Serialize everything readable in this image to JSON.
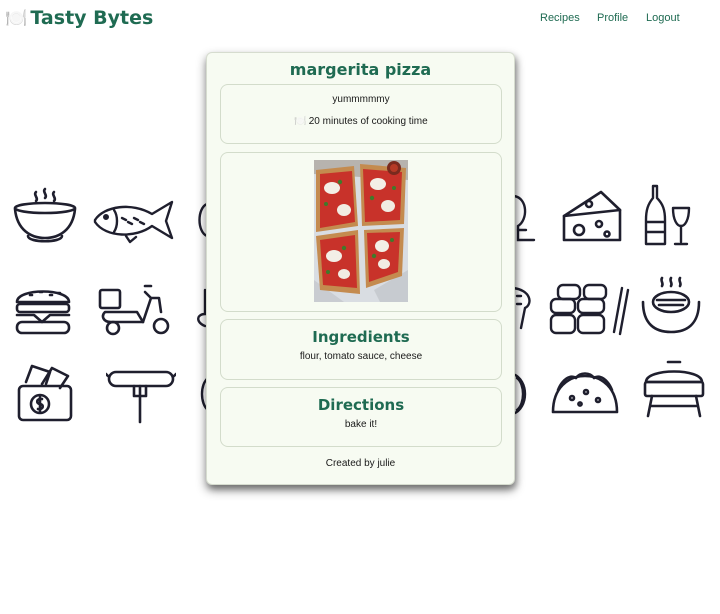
{
  "header": {
    "brand_icon": "🍽️",
    "brand_name": "Tasty Bytes",
    "nav": {
      "recipes": "Recipes",
      "profile": "Profile",
      "logout": "Logout"
    }
  },
  "background_icons": [
    "soup-bowl-icon",
    "fish-icon",
    "cheese-icon",
    "champagne-glass-icon",
    "burger-icon",
    "delivery-scooter-icon",
    "sushi-icon",
    "grill-bowl-icon",
    "money-bag-icon",
    "sausage-fork-icon",
    "taco-icon",
    "bbq-grill-icon"
  ],
  "recipe": {
    "title": "margerita pizza",
    "description": "yummmmmy",
    "time_icon": "🍽️",
    "time": "20 minutes of cooking time",
    "image_alt": "pizza-photo",
    "ingredients_heading": "Ingredients",
    "ingredients": "flour, tomato sauce, cheese",
    "directions_heading": "Directions",
    "directions": "bake it!",
    "author": "Created by julie"
  },
  "colors": {
    "accent": "#1f6b52",
    "card_bg": "#f7fbf2",
    "icon_stroke": "#1f1f2e"
  }
}
